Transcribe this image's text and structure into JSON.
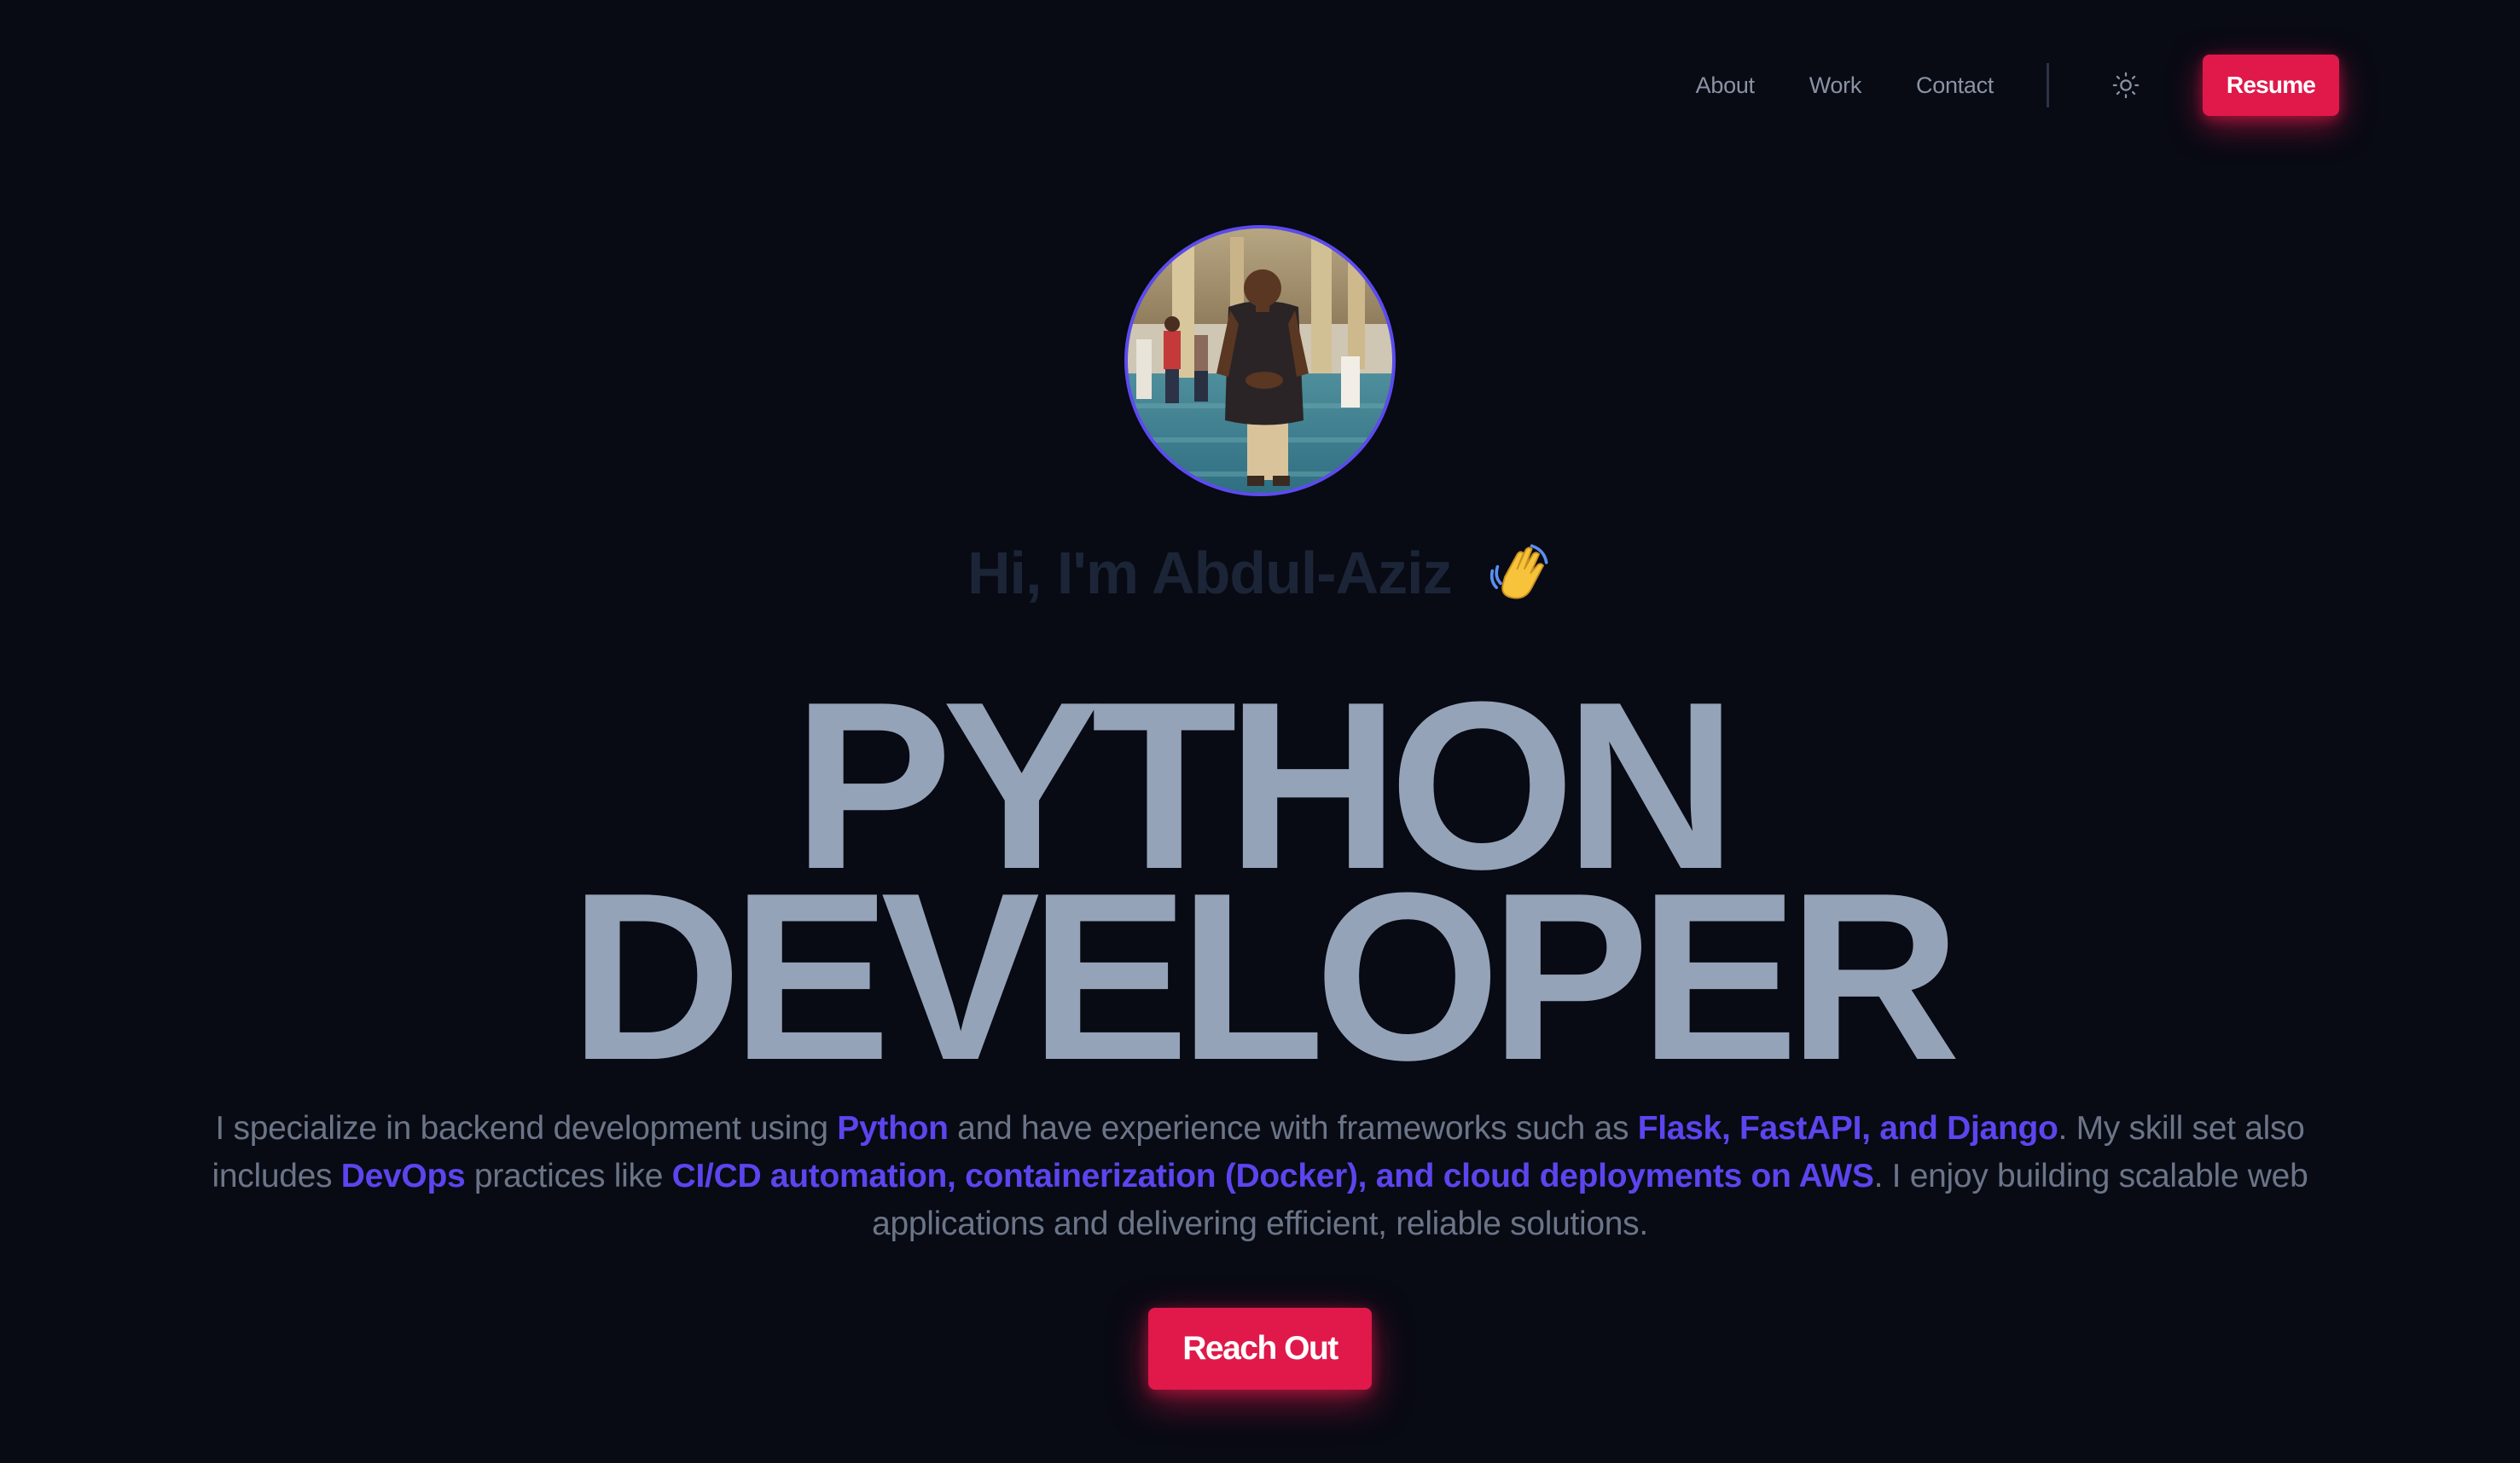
{
  "nav": {
    "links": [
      "About",
      "Work",
      "Contact"
    ],
    "theme_toggle_icon": "sun-icon",
    "resume_label": "Resume"
  },
  "hero": {
    "avatar_icon": "profile-photo",
    "greeting": "Hi, I'm Abdul-Aziz",
    "greeting_icon": "waving-hand-icon",
    "headline_line1": "PYTHON",
    "headline_line2": "DEVELOPER",
    "description": {
      "p1": "I specialize in backend development using ",
      "h1": "Python",
      "p2": " and have experience with frameworks such as ",
      "h2": "Flask, FastAPI, and Django",
      "p3": ". My skill set also includes ",
      "h3": "DevOps",
      "p4": " practices like ",
      "h4": "CI/CD automation, containerization (Docker), and cloud deployments on AWS",
      "p5": ". I enjoy building scalable web applications and delivering efficient, reliable solutions."
    },
    "cta_label": "Reach Out"
  },
  "colors": {
    "background": "#080a14",
    "accent": "#e0194a",
    "highlight": "#5b45ee",
    "headline": "#94a3b8",
    "avatar_border": "#5b4bf0"
  }
}
